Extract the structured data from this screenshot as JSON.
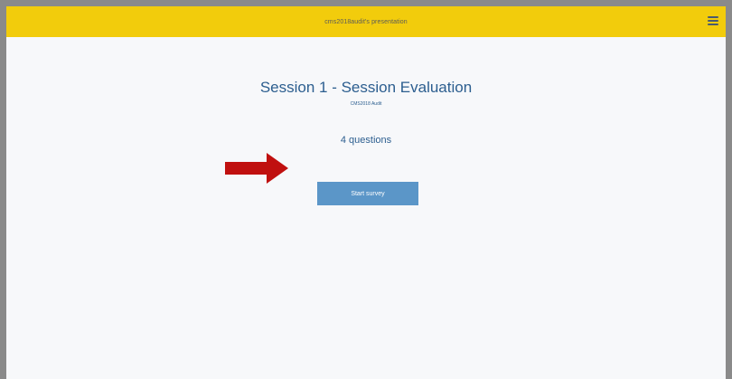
{
  "topbar": {
    "title": "cms2018audit's presentation",
    "menu_icon": "hamburger-menu-icon",
    "background": "#f2cc0c"
  },
  "survey": {
    "title": "Session 1 - Session Evaluation",
    "subtitle": "CMS2018 Audit",
    "question_count": "4 questions",
    "start_label": "Start survey",
    "title_color": "#2c5e8f",
    "button_color": "#5b96c8"
  },
  "annotation": {
    "arrow_icon": "right-arrow-icon",
    "arrow_color": "#c0100f"
  }
}
